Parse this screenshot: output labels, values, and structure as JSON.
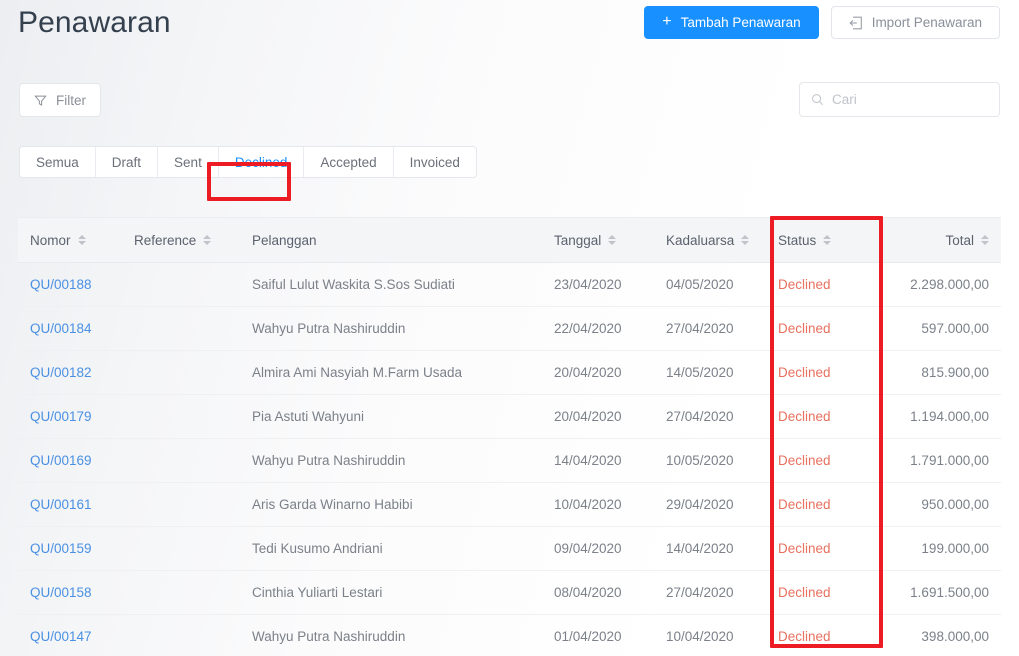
{
  "header": {
    "title": "Penawaran",
    "add_button": {
      "label": "Tambah Penawaran",
      "icon": "plus-icon"
    },
    "import_button": {
      "label": "Import Penawaran",
      "icon": "import-icon"
    },
    "primary_color": "#1890ff"
  },
  "toolbar": {
    "filter_label": "Filter",
    "filter_icon": "funnel-icon",
    "search": {
      "value": "",
      "placeholder": "Cari",
      "icon": "search-icon"
    }
  },
  "tabs": [
    {
      "label": "Semua",
      "active": false
    },
    {
      "label": "Draft",
      "active": false
    },
    {
      "label": "Sent",
      "active": false
    },
    {
      "label": "Declined",
      "active": true
    },
    {
      "label": "Accepted",
      "active": false
    },
    {
      "label": "Invoiced",
      "active": false
    }
  ],
  "table": {
    "columns": [
      {
        "key": "nomor",
        "label": "Nomor",
        "sortable": true,
        "align": "left"
      },
      {
        "key": "reference",
        "label": "Reference",
        "sortable": true,
        "align": "left"
      },
      {
        "key": "pelanggan",
        "label": "Pelanggan",
        "sortable": false,
        "align": "left"
      },
      {
        "key": "tanggal",
        "label": "Tanggal",
        "sortable": true,
        "align": "left"
      },
      {
        "key": "kadaluarsa",
        "label": "Kadaluarsa",
        "sortable": true,
        "align": "left"
      },
      {
        "key": "status",
        "label": "Status",
        "sortable": true,
        "align": "left"
      },
      {
        "key": "total",
        "label": "Total",
        "sortable": true,
        "align": "right"
      }
    ],
    "rows": [
      {
        "nomor": "QU/00188",
        "reference": "",
        "pelanggan": "Saiful Lulut Waskita S.Sos Sudiati",
        "tanggal": "23/04/2020",
        "kadaluarsa": "04/05/2020",
        "status": "Declined",
        "total": "2.298.000,00"
      },
      {
        "nomor": "QU/00184",
        "reference": "",
        "pelanggan": "Wahyu Putra Nashiruddin",
        "tanggal": "22/04/2020",
        "kadaluarsa": "27/04/2020",
        "status": "Declined",
        "total": "597.000,00"
      },
      {
        "nomor": "QU/00182",
        "reference": "",
        "pelanggan": "Almira Ami Nasyiah M.Farm Usada",
        "tanggal": "20/04/2020",
        "kadaluarsa": "14/05/2020",
        "status": "Declined",
        "total": "815.900,00"
      },
      {
        "nomor": "QU/00179",
        "reference": "",
        "pelanggan": "Pia Astuti Wahyuni",
        "tanggal": "20/04/2020",
        "kadaluarsa": "27/04/2020",
        "status": "Declined",
        "total": "1.194.000,00"
      },
      {
        "nomor": "QU/00169",
        "reference": "",
        "pelanggan": "Wahyu Putra Nashiruddin",
        "tanggal": "14/04/2020",
        "kadaluarsa": "10/05/2020",
        "status": "Declined",
        "total": "1.791.000,00"
      },
      {
        "nomor": "QU/00161",
        "reference": "",
        "pelanggan": "Aris Garda Winarno Habibi",
        "tanggal": "10/04/2020",
        "kadaluarsa": "29/04/2020",
        "status": "Declined",
        "total": "950.000,00"
      },
      {
        "nomor": "QU/00159",
        "reference": "",
        "pelanggan": "Tedi Kusumo Andriani",
        "tanggal": "09/04/2020",
        "kadaluarsa": "14/04/2020",
        "status": "Declined",
        "total": "199.000,00"
      },
      {
        "nomor": "QU/00158",
        "reference": "",
        "pelanggan": "Cinthia Yuliarti Lestari",
        "tanggal": "08/04/2020",
        "kadaluarsa": "27/04/2020",
        "status": "Declined",
        "total": "1.691.500,00"
      },
      {
        "nomor": "QU/00147",
        "reference": "",
        "pelanggan": "Wahyu Putra Nashiruddin",
        "tanggal": "01/04/2020",
        "kadaluarsa": "10/04/2020",
        "status": "Declined",
        "total": "398.000,00"
      }
    ]
  },
  "annotations": [
    {
      "name": "declined-tab-highlight",
      "color": "#ed1c24"
    },
    {
      "name": "status-column-highlight",
      "color": "#ed1c24"
    }
  ],
  "colors": {
    "link": "#4a90e2",
    "status_declined": "#e8715f",
    "header_bg": "#f4f5f7",
    "annotation": "#ed1c24"
  }
}
